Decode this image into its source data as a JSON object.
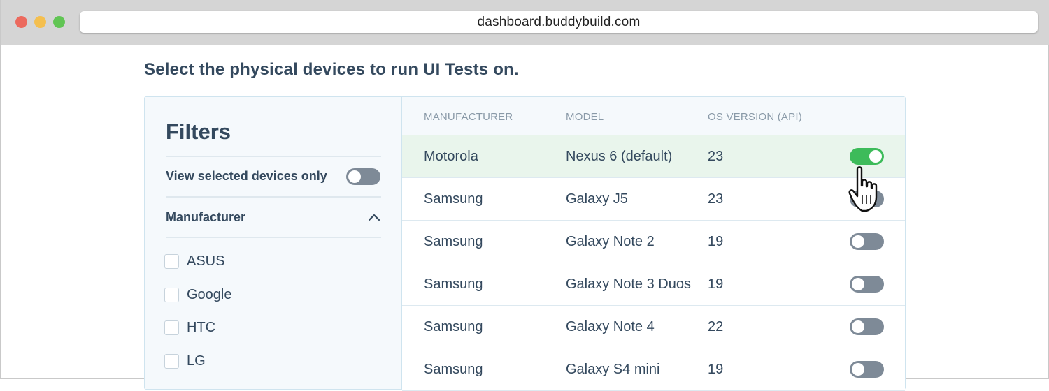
{
  "browser": {
    "url": "dashboard.buddybuild.com"
  },
  "page": {
    "heading": "Select the physical devices to run UI Tests on."
  },
  "filters": {
    "title": "Filters",
    "view_selected_label": "View selected devices only",
    "view_selected_on": false,
    "manufacturer_label": "Manufacturer",
    "manufacturers": [
      {
        "label": "ASUS",
        "checked": false
      },
      {
        "label": "Google",
        "checked": false
      },
      {
        "label": "HTC",
        "checked": false
      },
      {
        "label": "LG",
        "checked": false
      }
    ]
  },
  "table": {
    "headers": {
      "manufacturer": "MANUFACTURER",
      "model": "MODEL",
      "os_version": "OS VERSION (API)"
    },
    "rows": [
      {
        "manufacturer": "Motorola",
        "model": "Nexus 6 (default)",
        "os": "23",
        "enabled": true
      },
      {
        "manufacturer": "Samsung",
        "model": "Galaxy J5",
        "os": "23",
        "enabled": false
      },
      {
        "manufacturer": "Samsung",
        "model": "Galaxy Note 2",
        "os": "19",
        "enabled": false
      },
      {
        "manufacturer": "Samsung",
        "model": "Galaxy Note 3 Duos",
        "os": "19",
        "enabled": false
      },
      {
        "manufacturer": "Samsung",
        "model": "Galaxy Note 4",
        "os": "22",
        "enabled": false
      },
      {
        "manufacturer": "Samsung",
        "model": "Galaxy S4 mini",
        "os": "19",
        "enabled": false
      }
    ]
  },
  "colors": {
    "toggle_on": "#3dbb5a",
    "toggle_off": "#7e8a97",
    "selected_row": "#e9f5ec",
    "text": "#34495e"
  },
  "icons": {
    "cursor": "pointing-hand-cursor-icon",
    "collapse": "chevron-up-icon"
  }
}
